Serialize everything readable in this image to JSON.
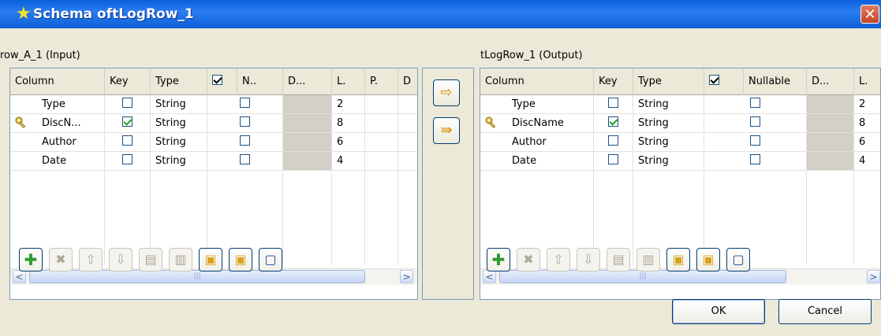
{
  "window": {
    "title": "Schema oftLogRow_1",
    "close_glyph": "✕"
  },
  "input_panel": {
    "label": "row_A_1 (Input)",
    "headers": [
      "Column",
      "Key",
      "Type",
      "",
      "N..",
      "D...",
      "L.",
      "P.",
      "D"
    ],
    "rows": [
      {
        "column": "Type",
        "key": false,
        "type": "String",
        "nullable": false,
        "length": "2"
      },
      {
        "column": "DiscN...",
        "key": true,
        "type": "String",
        "nullable": false,
        "length": "8"
      },
      {
        "column": "Author",
        "key": false,
        "type": "String",
        "nullable": false,
        "length": "6"
      },
      {
        "column": "Date",
        "key": false,
        "type": "String",
        "nullable": false,
        "length": "4"
      }
    ]
  },
  "output_panel": {
    "label": "tLogRow_1 (Output)",
    "headers": [
      "Column",
      "Key",
      "Type",
      "",
      "Nullable",
      "D...",
      "L."
    ],
    "rows": [
      {
        "column": "Type",
        "key": false,
        "type": "String",
        "nullable": false,
        "length": "2"
      },
      {
        "column": "DiscName",
        "key": true,
        "type": "String",
        "nullable": false,
        "length": "8"
      },
      {
        "column": "Author",
        "key": false,
        "type": "String",
        "nullable": false,
        "length": "6"
      },
      {
        "column": "Date",
        "key": false,
        "type": "String",
        "nullable": false,
        "length": "4"
      }
    ]
  },
  "transfer": {
    "copy_selected_icon": "arrow-right-icon",
    "copy_all_icon": "double-arrow-right-icon"
  },
  "toolbar_icons": [
    "add-icon",
    "delete-icon",
    "move-up-icon",
    "move-down-icon",
    "copy-icon",
    "paste-icon",
    "import-icon",
    "export-icon",
    "save-icon"
  ],
  "buttons": {
    "ok": "OK",
    "cancel": "Cancel"
  },
  "colors": {
    "titlebar": "#0a5fdb",
    "key_check": "#21a121"
  }
}
